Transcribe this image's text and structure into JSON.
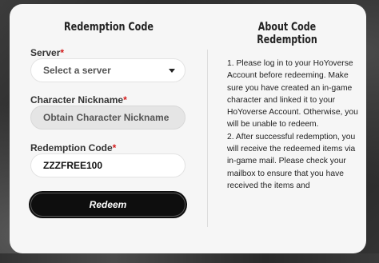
{
  "form": {
    "title": "Redemption Code",
    "server_label": "Server",
    "server_placeholder": "Select a server",
    "nickname_label": "Character Nickname",
    "nickname_placeholder": "Obtain Character Nickname",
    "code_label": "Redemption Code",
    "code_value": "ZZZFREE100",
    "required_mark": "*",
    "redeem_label": "Redeem"
  },
  "about": {
    "title_line1": "About Code",
    "title_line2": "Redemption",
    "paragraph1": "1. Please log in to your HoYoverse Account before redeeming. Make sure you have created an in-game character and linked it to your HoYoverse Account. Otherwise, you will be unable to redeem.",
    "paragraph2": "2. After successful redemption, you will receive the redeemed items via in-game mail. Please check your mailbox to ensure that you have received the items and"
  },
  "colors": {
    "required": "#d31a1a",
    "button_bg": "#0e0e0e",
    "card_bg": "#f6f6f6"
  }
}
